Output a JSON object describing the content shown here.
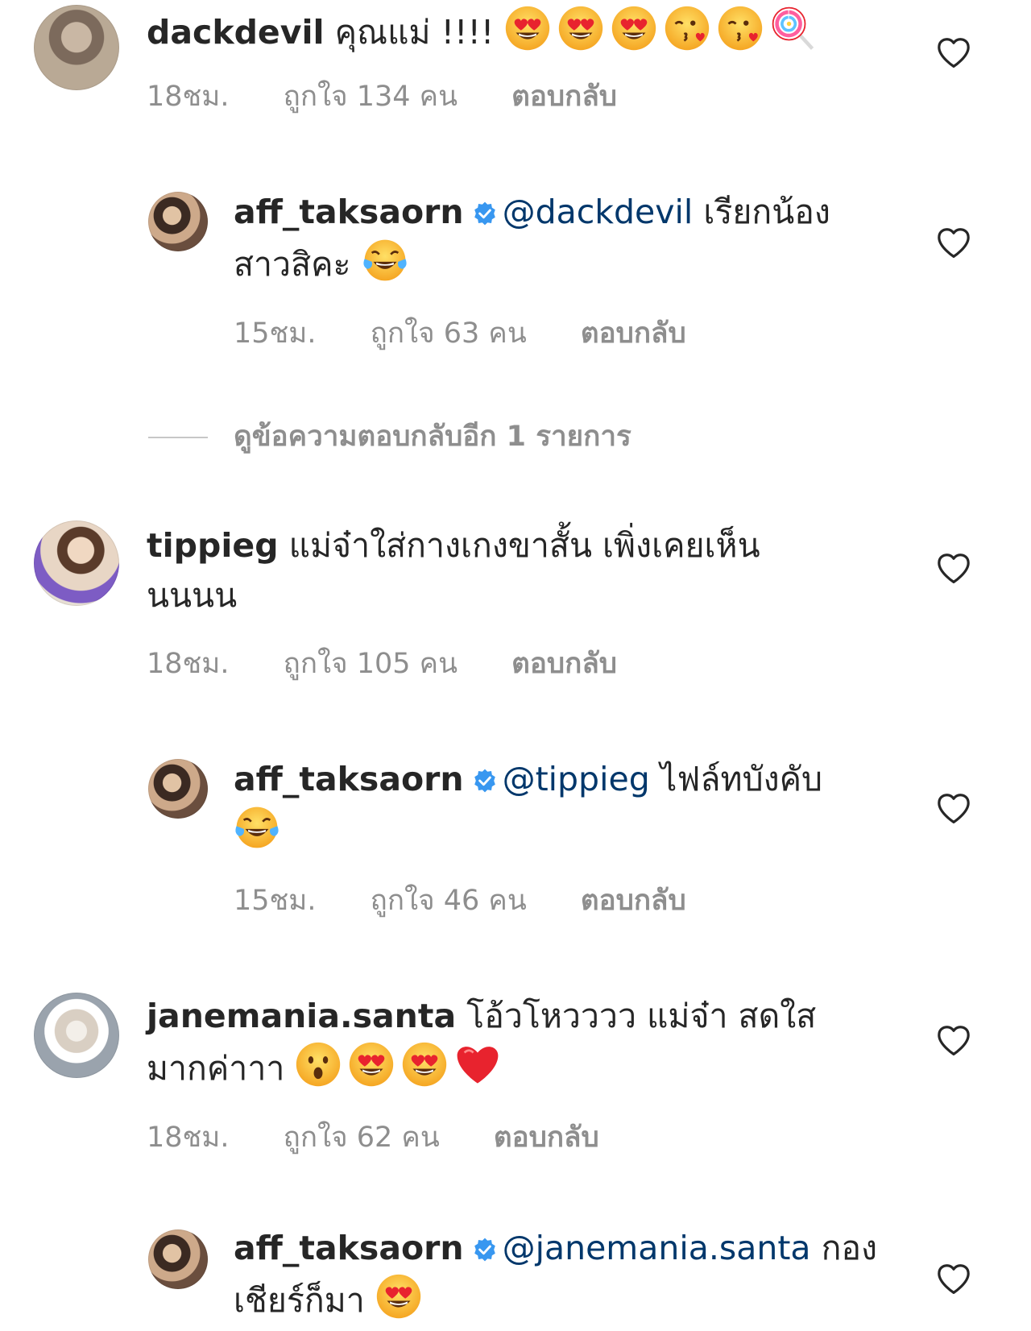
{
  "colors": {
    "text": "#262626",
    "meta": "#8e8e8e",
    "mention": "#00376b",
    "verified": "#3897f0"
  },
  "comments": [
    {
      "username": "dackdevil",
      "text": "คุณแม่ !!!!",
      "emojis": [
        "heart-eyes",
        "heart-eyes",
        "heart-eyes",
        "kissing-heart",
        "kissing-heart",
        "lollipop"
      ],
      "time": "18ชม.",
      "likes": "ถูกใจ 134 คน",
      "reply_label": "ตอบกลับ",
      "replies": [
        {
          "username": "aff_taksaorn",
          "verified": true,
          "mention": "@dackdevil",
          "text": "เรียกน้องสาวสิคะ",
          "emojis": [
            "tears-of-joy"
          ],
          "time": "15ชม.",
          "likes": "ถูกใจ 63 คน",
          "reply_label": "ตอบกลับ"
        }
      ],
      "view_more": "ดูข้อความตอบกลับอีก 1 รายการ"
    },
    {
      "username": "tippieg",
      "text": "แม่จ๋าใส่กางเกงขาสั้น เพิ่งเคยเห็นนนนน",
      "emojis": [],
      "time": "18ชม.",
      "likes": "ถูกใจ 105 คน",
      "reply_label": "ตอบกลับ",
      "replies": [
        {
          "username": "aff_taksaorn",
          "verified": true,
          "mention": "@tippieg",
          "text": "ไฟล์ทบังคับ",
          "emojis": [
            "tears-of-joy"
          ],
          "time": "15ชม.",
          "likes": "ถูกใจ 46 คน",
          "reply_label": "ตอบกลับ"
        }
      ]
    },
    {
      "username": "janemania.santa",
      "text": "โอ้วโหวววว แม่จ๋า สดใสมากค่าาา",
      "emojis": [
        "hushed",
        "heart-eyes",
        "heart-eyes",
        "red-heart"
      ],
      "time": "18ชม.",
      "likes": "ถูกใจ 62 คน",
      "reply_label": "ตอบกลับ",
      "replies": [
        {
          "username": "aff_taksaorn",
          "verified": true,
          "mention": "@janemania.santa",
          "text": "กองเชียร์ก็มา",
          "emojis": [
            "heart-eyes"
          ]
        }
      ]
    }
  ]
}
